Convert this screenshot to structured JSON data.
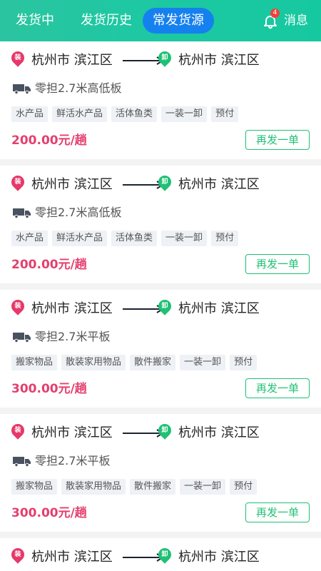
{
  "header": {
    "tabs": [
      "发货中",
      "发货历史",
      "常发货源"
    ],
    "active_tab": 2,
    "notification_count": "4",
    "message_label": "消息"
  },
  "pins": {
    "load": "装",
    "unload": "卸"
  },
  "cards": [
    {
      "from": "杭州市 滨江区",
      "to": "杭州市 滨江区",
      "vehicle": "零担2.7米高低板",
      "tags": [
        "水产品",
        "鲜活水产品",
        "活体鱼类",
        "一装一卸",
        "预付"
      ],
      "price": "200.00元/趟",
      "action": "再发一单"
    },
    {
      "from": "杭州市 滨江区",
      "to": "杭州市 滨江区",
      "vehicle": "零担2.7米高低板",
      "tags": [
        "水产品",
        "鲜活水产品",
        "活体鱼类",
        "一装一卸",
        "预付"
      ],
      "price": "200.00元/趟",
      "action": "再发一单"
    },
    {
      "from": "杭州市 滨江区",
      "to": "杭州市 滨江区",
      "vehicle": "零担2.7米平板",
      "tags": [
        "搬家物品",
        "散装家用物品",
        "散件搬家",
        "一装一卸",
        "预付"
      ],
      "price": "300.00元/趟",
      "action": "再发一单"
    },
    {
      "from": "杭州市 滨江区",
      "to": "杭州市 滨江区",
      "vehicle": "零担2.7米平板",
      "tags": [
        "搬家物品",
        "散装家用物品",
        "散件搬家",
        "一装一卸",
        "预付"
      ],
      "price": "300.00元/趟",
      "action": "再发一单"
    },
    {
      "from": "杭州市 滨江区",
      "to": "杭州市 滨江区"
    }
  ],
  "colors": {
    "header_start": "#2bc4a0",
    "active_tab_bg": "#1581ee",
    "load_pin": "#e6386a",
    "unload_pin": "#1fc174",
    "price": "#e43f6e",
    "action_border": "#1fc174"
  },
  "icons": {
    "bell": "bell-icon",
    "truck": "truck-icon",
    "arrow": "arrow-right-icon"
  }
}
